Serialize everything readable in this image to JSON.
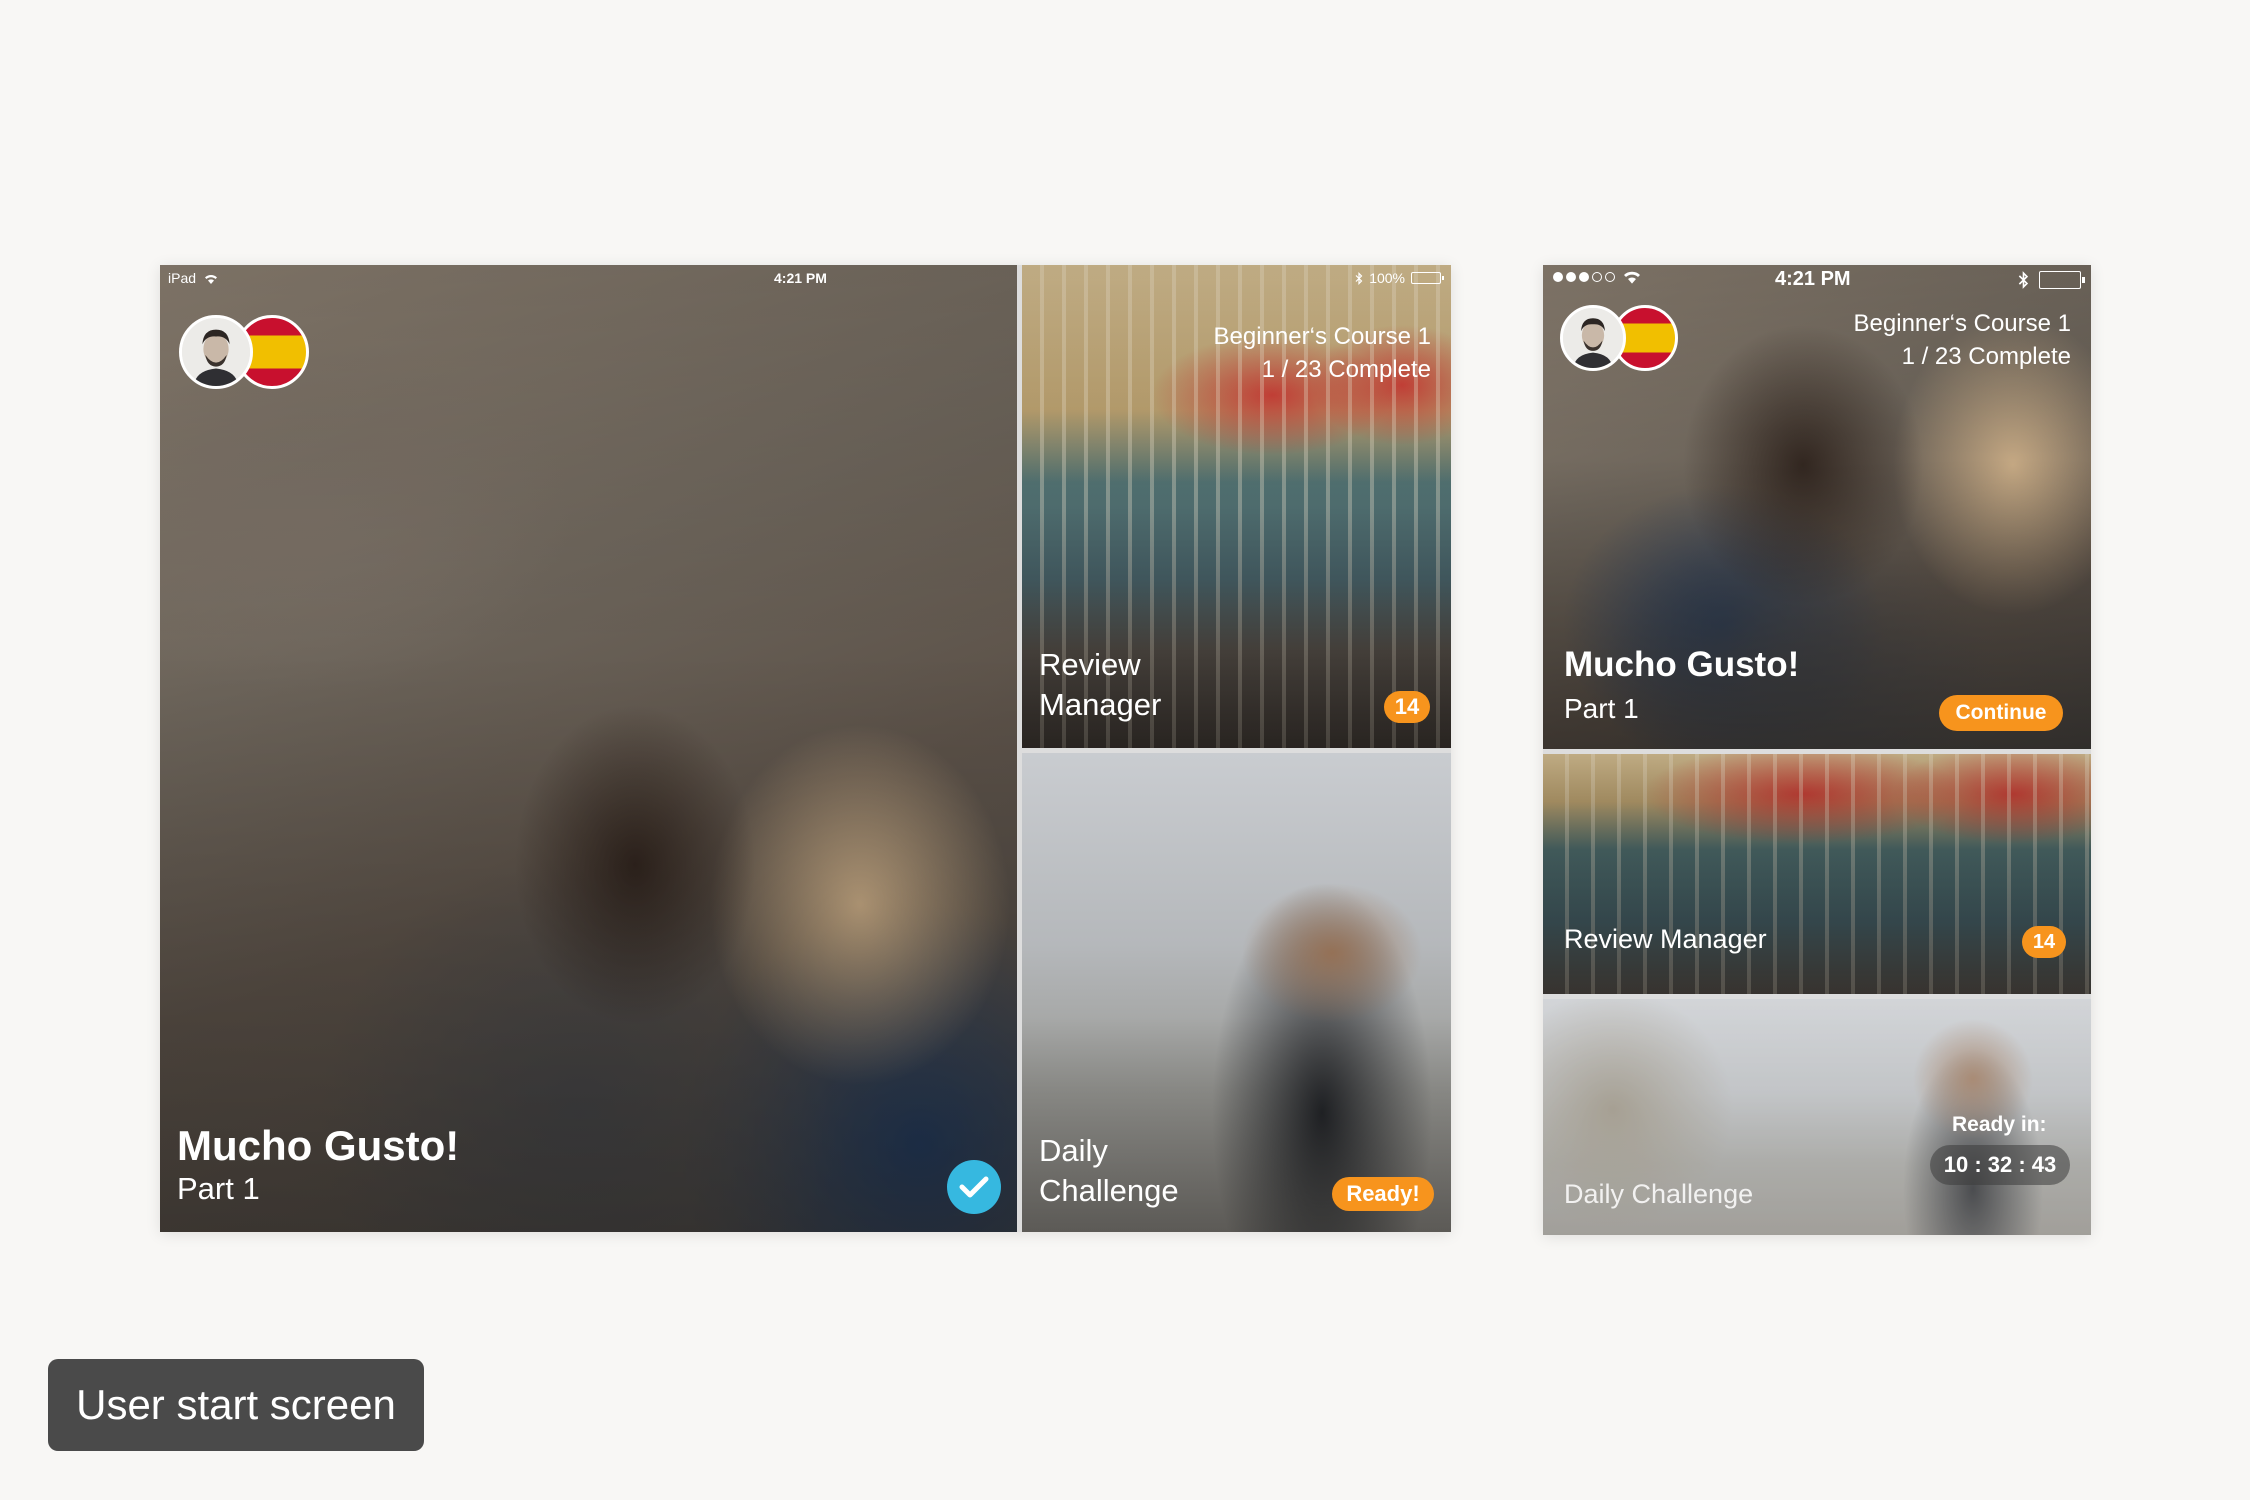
{
  "tablet": {
    "status_bar": {
      "carrier": "iPad",
      "time": "4:21 PM",
      "battery": "100%"
    },
    "course": {
      "title": "Beginner‘s Course 1",
      "progress": "1 / 23 Complete"
    },
    "hero": {
      "title": "Mucho Gusto!",
      "subtitle": "Part 1",
      "completed": true
    },
    "review": {
      "line1": "Review",
      "line2": "Manager",
      "badge": "14"
    },
    "daily": {
      "line1": "Daily",
      "line2": "Challenge",
      "badge": "Ready!"
    }
  },
  "phone": {
    "status_bar": {
      "time": "4:21 PM",
      "signal_bars": 3
    },
    "course": {
      "title": "Beginner‘s Course 1",
      "progress": "1 / 23 Complete"
    },
    "hero": {
      "title": "Mucho Gusto!",
      "subtitle": "Part 1",
      "button": "Continue"
    },
    "review": {
      "title": "Review Manager",
      "badge": "14"
    },
    "daily": {
      "title": "Daily Challenge",
      "ready_label": "Ready in:",
      "timer": "10 : 32 : 43"
    }
  },
  "caption": "User start screen",
  "colors": {
    "accent": "#f7941d",
    "check": "#36b8e0",
    "caption_bg": "#4a4a4a"
  },
  "icons": [
    "wifi-icon",
    "battery-icon",
    "bluetooth-icon",
    "checkmark-icon",
    "avatar",
    "spain-flag-icon"
  ]
}
